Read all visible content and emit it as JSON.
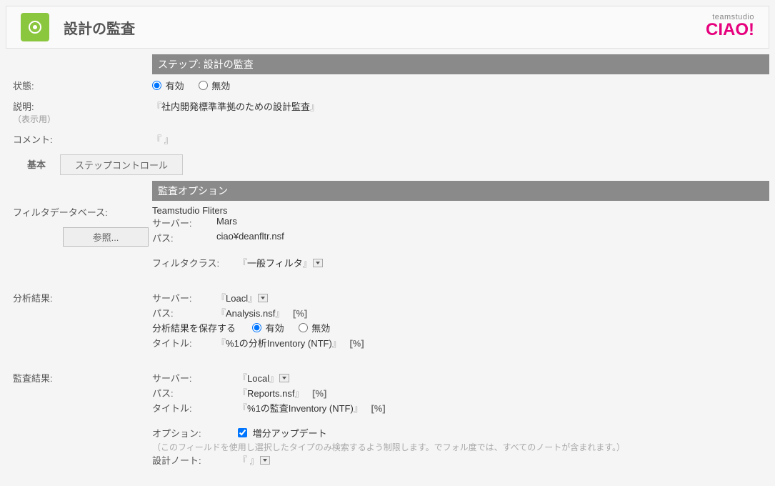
{
  "header": {
    "title": "設計の監査",
    "brand_top": "teamstudio",
    "brand_main": "CIAO!"
  },
  "step": {
    "bar_label": "ステップ:",
    "bar_title": "設計の監査",
    "status_label": "状態:",
    "status_enabled": "有効",
    "status_disabled": "無効",
    "desc_label": "説明:",
    "desc_sublabel": "（表示用）",
    "desc_value": "社内開発標準準拠のための設計監査",
    "comment_label": "コメント:",
    "comment_value": " "
  },
  "tabs": {
    "basic": "基本",
    "step_control": "ステップコントロール"
  },
  "audit": {
    "bar_title": "監査オプション",
    "filter_db_label": "フィルタデータベース:",
    "filter_db_name": "Teamstudio Fliters",
    "server_label": "サーバー:",
    "server_value": "Mars",
    "path_label": "パス:",
    "path_value": "ciao¥deanfltr.nsf",
    "browse_label": "参照...",
    "filter_class_label": "フィルタクラス:",
    "filter_class_value": "一般フィルタ"
  },
  "analysis": {
    "label": "分析結果:",
    "server_label": "サーバー:",
    "server_value": "Loacl",
    "path_label": "パス:",
    "path_value": "Analysis.nsf",
    "save_label": "分析結果を保存する",
    "save_enabled": "有効",
    "save_disabled": "無効",
    "title_label": "タイトル:",
    "title_value": "%1の分析Inventory (NTF)"
  },
  "auditres": {
    "label": "監査結果:",
    "server_label": "サーバー:",
    "server_value": "Local",
    "path_label": "パス:",
    "path_value": "Reports.nsf",
    "title_label": "タイトル:",
    "title_value": "%1の監査Inventory (NTF)",
    "option_label": "オプション:",
    "option_value": "増分アップデート",
    "hint": "（このフィールドを使用し選択したタイプのみ検索するよう制限します。でフォル度では、すべてのノートが含まれます。）",
    "design_note_label": "設計ノート:",
    "design_note_value": " "
  }
}
